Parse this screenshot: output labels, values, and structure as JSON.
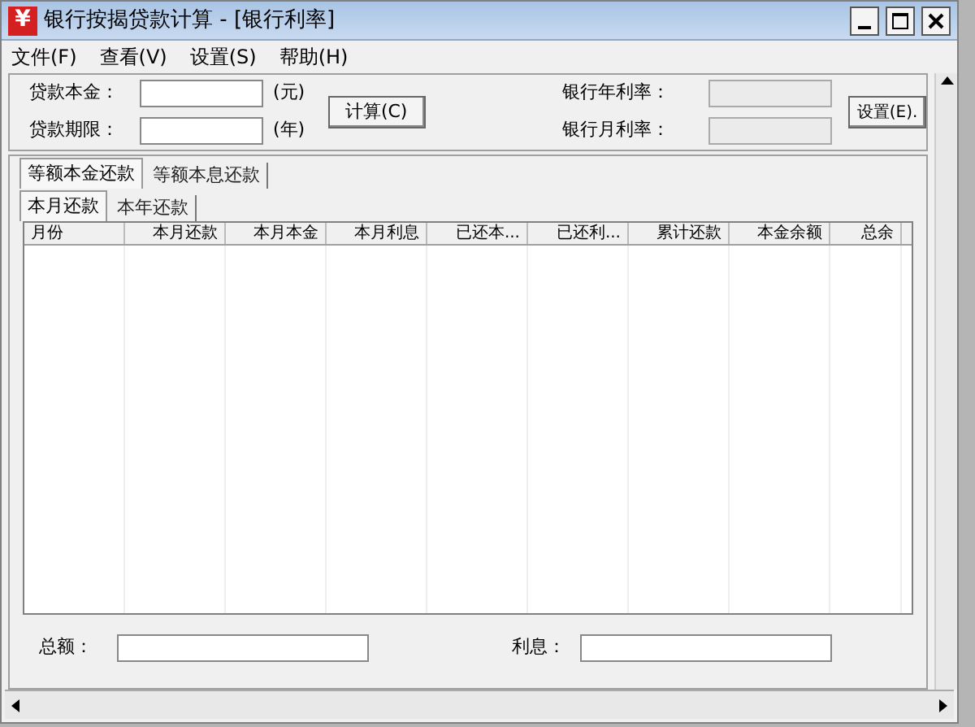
{
  "window": {
    "icon": "¥",
    "title": "银行按揭贷款计算 - [银行利率]"
  },
  "menu": [
    "文件(F)",
    "查看(V)",
    "设置(S)",
    "帮助(H)"
  ],
  "inputs": {
    "principal": {
      "label": "贷款本金：",
      "unit": "(元)"
    },
    "term": {
      "label": "贷款期限：",
      "unit": "(年)"
    },
    "calculate_button": "计算(C)",
    "annual_rate": {
      "label": "银行年利率："
    },
    "monthly_rate": {
      "label": "银行月利率："
    },
    "settings_button": "设置(E)."
  },
  "method_tabs": [
    {
      "label": "等额本金还款",
      "selected": true
    },
    {
      "label": "等额本息还款",
      "selected": false
    }
  ],
  "period_tabs": [
    {
      "label": "本月还款",
      "selected": true
    },
    {
      "label": "本年还款",
      "selected": false
    }
  ],
  "table": {
    "columns": [
      "月份",
      "本月还款",
      "本月本金",
      "本月利息",
      "已还本...",
      "已还利...",
      "累计还款",
      "本金余额",
      "总余"
    ]
  },
  "summary": {
    "total_label": "总额：",
    "interest_label": "利息："
  }
}
